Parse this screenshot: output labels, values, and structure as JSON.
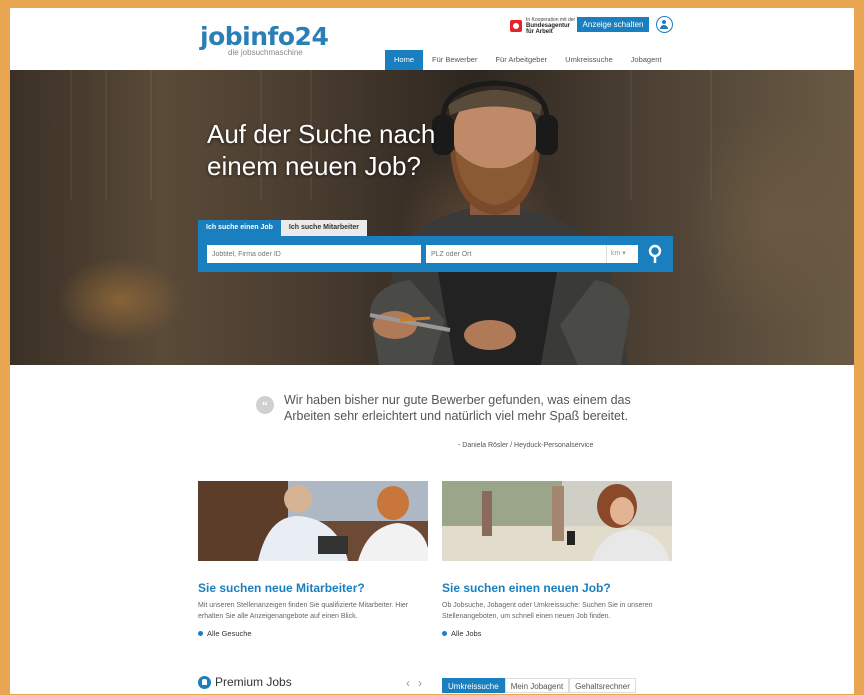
{
  "header": {
    "logo_main": "jobinfo24",
    "logo_sub": "die jobsuchmaschine",
    "ba_small": "In Kooperation mit der",
    "ba_line1": "Bundesagentur",
    "ba_line2": "für Arbeit",
    "ad_button": "Anzeige schalten"
  },
  "nav": {
    "items": [
      {
        "label": "Home"
      },
      {
        "label": "Für Bewerber"
      },
      {
        "label": "Für Arbeitgeber"
      },
      {
        "label": "Umkreissuche"
      },
      {
        "label": "Jobagent"
      }
    ]
  },
  "hero": {
    "headline_line1": "Auf der Suche nach",
    "headline_line2": "einem neuen Job?",
    "tab_active": "Ich suche einen Job",
    "tab_inactive": "Ich suche Mitarbeiter",
    "search_placeholder": "Jobtitel, Firma oder ID",
    "location_placeholder": "PLZ oder Ort",
    "km_label": "km"
  },
  "testimonial": {
    "text": "Wir haben bisher nur gute Bewerber gefunden, was einem das Arbeiten sehr erleichtert und natürlich viel mehr Spaß bereitet.",
    "author": "- Daniela Rösler / Heyduck-Personalservice"
  },
  "cards": [
    {
      "title": "Sie suchen neue Mitarbeiter?",
      "text": "Mit unseren Stellenanzeigen finden Sie qualifizierte Mitarbeiter. Hier erhalten Sie alle Anzeigenangebote auf einen Blick.",
      "link": "Alle Gesuche"
    },
    {
      "title": "Sie suchen einen neuen Job?",
      "text": "Ob Jobsuche, Jobagent oder Umkreissuche: Suchen Sie in unseren Stellenangeboten, um schnell einen neuen Job finden.",
      "link": "Alle Jobs"
    }
  ],
  "premium": {
    "title": "Premium Jobs",
    "prev": "‹",
    "next": "›"
  },
  "bottom_tabs": [
    {
      "label": "Umkreissuche"
    },
    {
      "label": "Mein Jobagent"
    },
    {
      "label": "Gehaltsrechner"
    }
  ],
  "colors": {
    "brand_blue": "#1a7fbf",
    "frame": "#e8a552"
  }
}
